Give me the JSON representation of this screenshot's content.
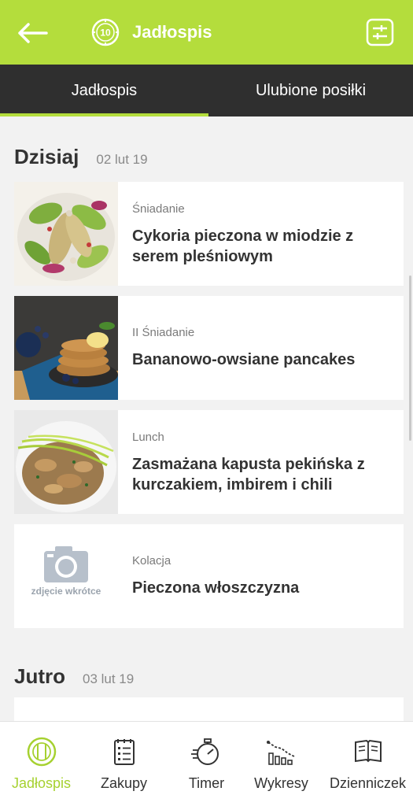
{
  "header": {
    "title": "Jadłospis",
    "logo_text": "10",
    "colors": {
      "accent": "#b4dd3c",
      "tab_bg": "#2f2f2f",
      "card_bg": "#ffffff"
    }
  },
  "tabs": [
    {
      "label": "Jadłospis",
      "active": true
    },
    {
      "label": "Ulubione posiłki",
      "active": false
    }
  ],
  "days": [
    {
      "title": "Dzisiaj",
      "date": "02 lut 19",
      "meals": [
        {
          "type": "Śniadanie",
          "name": "Cykoria pieczona w miodzie z serem pleśniowym",
          "image": "salad-photo"
        },
        {
          "type": "II Śniadanie",
          "name": "Bananowo-owsiane pancakes",
          "image": "pancakes-photo"
        },
        {
          "type": "Lunch",
          "name": "Zasmażana kapusta pekińska z kurczakiem, imbirem i chili",
          "image": "stirfry-photo"
        },
        {
          "type": "Kolacja",
          "name": "Pieczona włoszczyzna",
          "image": "camera-placeholder",
          "placeholder_text": "zdjęcie wkrótce"
        }
      ]
    },
    {
      "title": "Jutro",
      "date": "03 lut 19",
      "meals": []
    }
  ],
  "bottom_nav": [
    {
      "label": "Jadłospis",
      "icon": "plate-cutlery-icon",
      "active": true
    },
    {
      "label": "Zakupy",
      "icon": "shopping-list-icon",
      "active": false
    },
    {
      "label": "Timer",
      "icon": "stopwatch-icon",
      "active": false
    },
    {
      "label": "Wykresy",
      "icon": "chart-icon",
      "active": false
    },
    {
      "label": "Dzienniczek",
      "icon": "diary-book-icon",
      "active": false
    }
  ]
}
